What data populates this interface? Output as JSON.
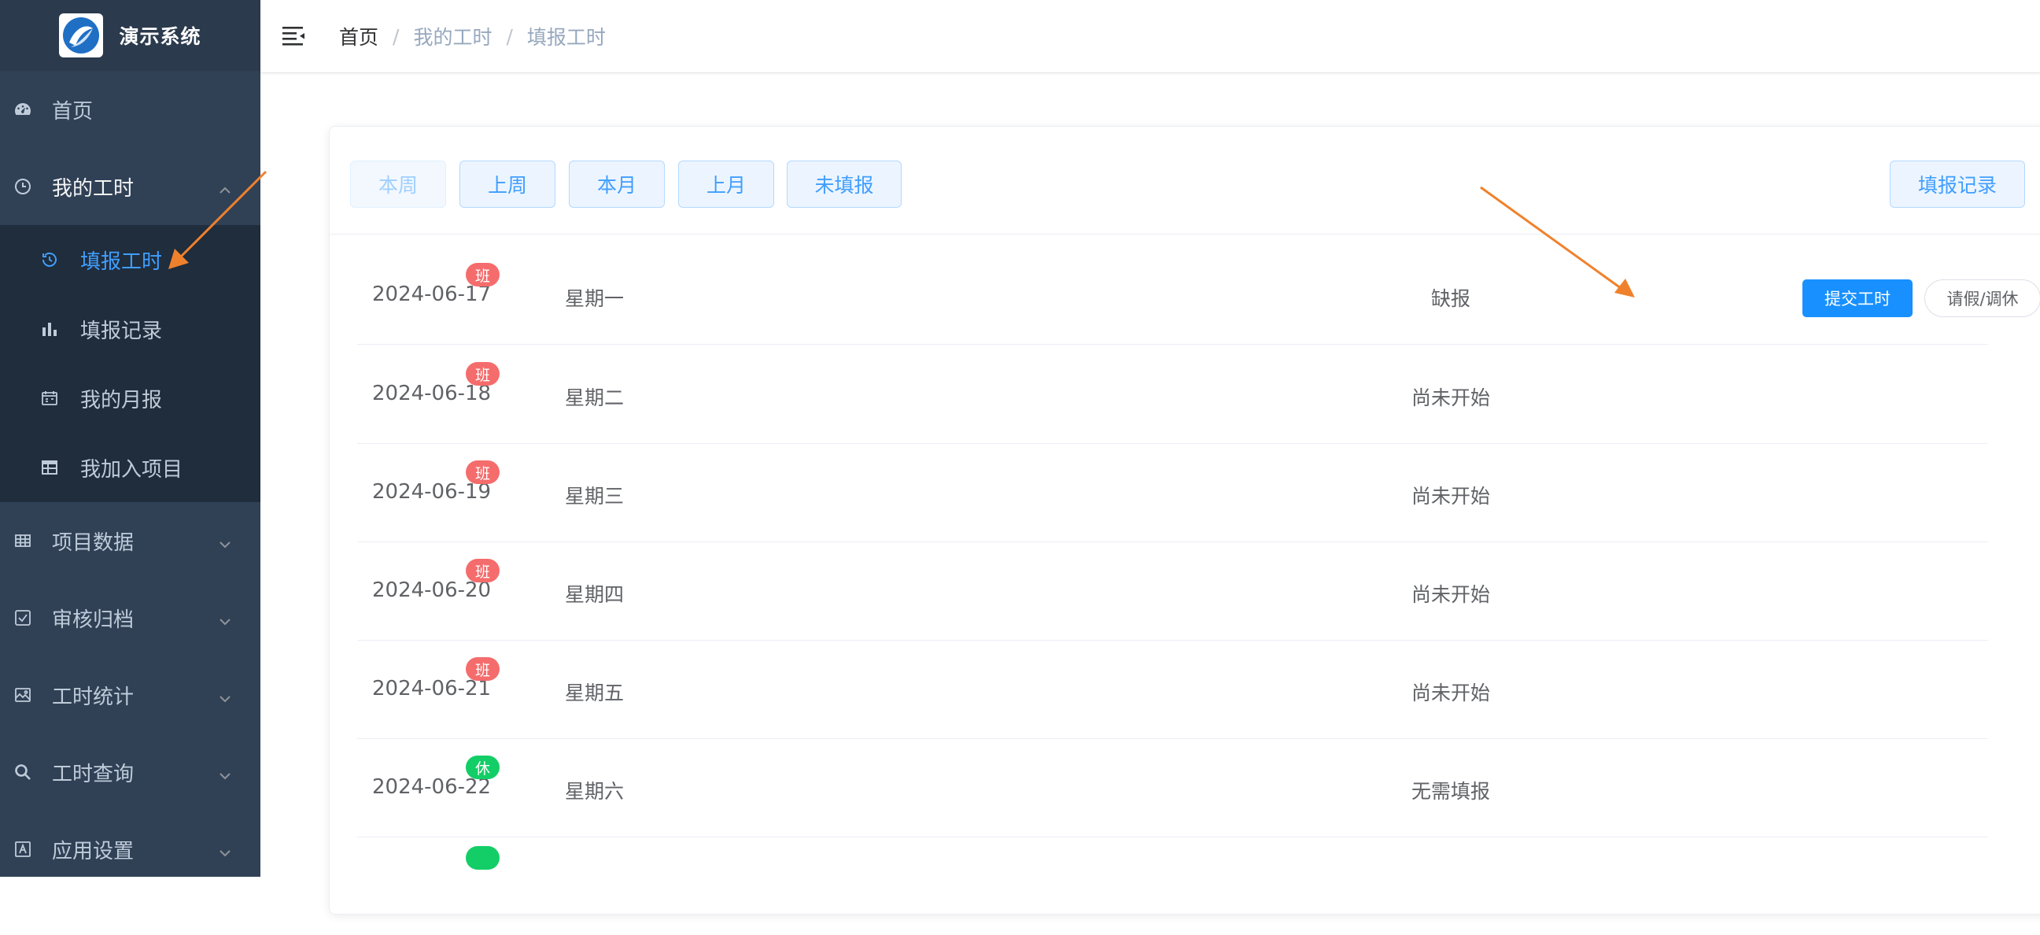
{
  "app": {
    "title": "演示系统"
  },
  "colors": {
    "sidebar": "#304156",
    "accent": "#409eff",
    "primary": "#1890ff",
    "work_tag": "#f56c6c",
    "rest_tag": "#13ce66",
    "annotation_arrow": "#f0812c"
  },
  "sidebar": {
    "items": [
      {
        "label": "首页",
        "icon": "dashboard-icon"
      },
      {
        "label": "我的工时",
        "icon": "clock-icon",
        "expanded": true,
        "children": [
          {
            "label": "填报工时",
            "icon": "refresh-clock-icon",
            "active": true
          },
          {
            "label": "填报记录",
            "icon": "bar-chart-icon"
          },
          {
            "label": "我的月报",
            "icon": "calendar-icon"
          },
          {
            "label": "我加入项目",
            "icon": "table-icon"
          }
        ]
      },
      {
        "label": "项目数据",
        "icon": "grid-icon"
      },
      {
        "label": "审核归档",
        "icon": "checkbox-icon"
      },
      {
        "label": "工时统计",
        "icon": "picture-icon"
      },
      {
        "label": "工时查询",
        "icon": "search-icon"
      },
      {
        "label": "应用设置",
        "icon": "app-icon"
      }
    ]
  },
  "header": {
    "breadcrumb": [
      "首页",
      "我的工时",
      "填报工时"
    ],
    "separator": "/"
  },
  "toolbar": {
    "buttons": [
      {
        "label": "本周",
        "disabled": true
      },
      {
        "label": "上周"
      },
      {
        "label": "本月"
      },
      {
        "label": "上月"
      },
      {
        "label": "未填报"
      }
    ],
    "record_button": "填报记录"
  },
  "days": [
    {
      "date": "2024-06-17",
      "tag": "班",
      "tag_type": "work",
      "weekday": "星期一",
      "status": "缺报",
      "submit": "提交工时",
      "leave": "请假/调休"
    },
    {
      "date": "2024-06-18",
      "tag": "班",
      "tag_type": "work",
      "weekday": "星期二",
      "status": "尚未开始"
    },
    {
      "date": "2024-06-19",
      "tag": "班",
      "tag_type": "work",
      "weekday": "星期三",
      "status": "尚未开始"
    },
    {
      "date": "2024-06-20",
      "tag": "班",
      "tag_type": "work",
      "weekday": "星期四",
      "status": "尚未开始"
    },
    {
      "date": "2024-06-21",
      "tag": "班",
      "tag_type": "work",
      "weekday": "星期五",
      "status": "尚未开始"
    },
    {
      "date": "2024-06-22",
      "tag": "休",
      "tag_type": "rest",
      "weekday": "星期六",
      "status": "无需填报"
    }
  ]
}
